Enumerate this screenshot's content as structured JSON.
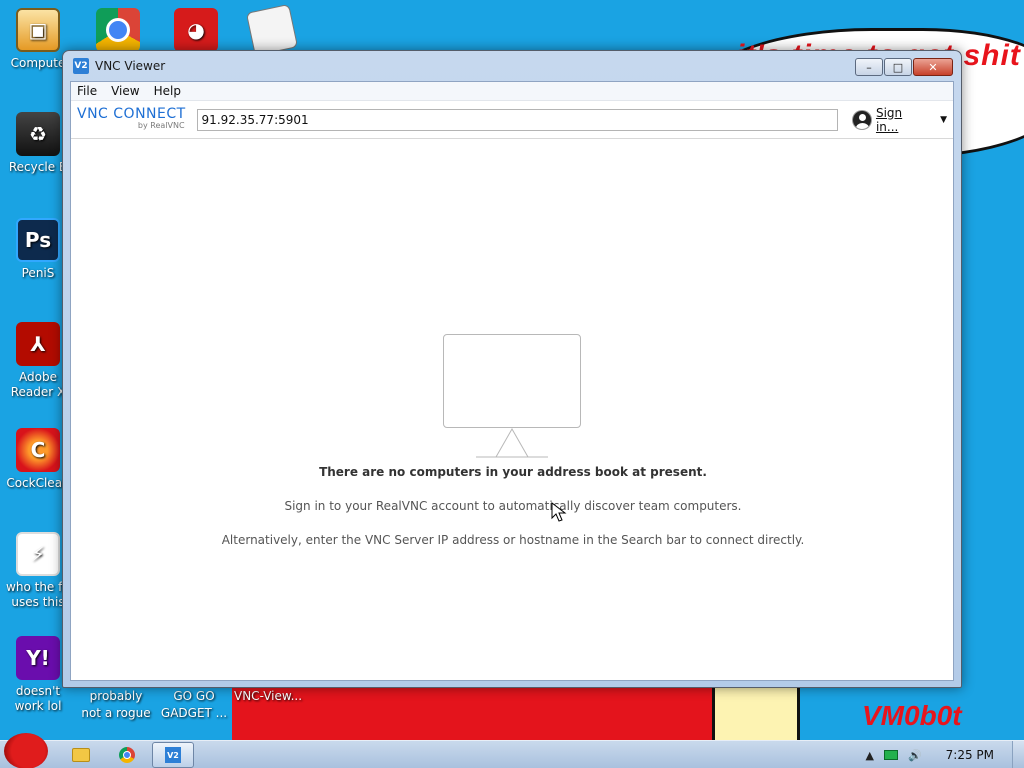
{
  "wallpaper": {
    "speech": "it's time to get shit\nnew",
    "sign": "VM0b0t"
  },
  "desktop_icons": [
    {
      "label": "Compute",
      "icon": "computer-icon"
    },
    {
      "label": "",
      "icon": "chrome-icon"
    },
    {
      "label": "",
      "icon": "angry-bird-icon"
    },
    {
      "label": "",
      "icon": "document-icon"
    },
    {
      "label": "Recycle B",
      "icon": "recycle-bin-icon"
    },
    {
      "label": "PeniS",
      "icon": "photoshop-icon"
    },
    {
      "label": "Adobe Reader X",
      "icon": "adobe-reader-icon"
    },
    {
      "label": "CockClean",
      "icon": "ccleaner-icon"
    },
    {
      "label": "who the fu uses this",
      "icon": "bolt-icon"
    },
    {
      "label": "doesn't work lol",
      "icon": "yahoo-icon"
    }
  ],
  "bottom_labels": [
    "probably not a rogue",
    "GO GO GADGET ...",
    "VNC-View..."
  ],
  "window": {
    "title": "VNC Viewer",
    "app_icon_text": "V2",
    "controls": {
      "minimize": "–",
      "maximize": "□",
      "close": "✕"
    }
  },
  "menu": [
    "File",
    "View",
    "Help"
  ],
  "brand": {
    "main": "VNC CONNECT",
    "sub": "by RealVNC"
  },
  "address_bar": {
    "value": "91.92.35.77:5901"
  },
  "signin": {
    "label": "Sign in...",
    "caret": "▼"
  },
  "empty_state": {
    "heading": "There are no computers in your address book at present.",
    "line1": "Sign in to your RealVNC account to automatically discover team computers.",
    "line2": "Alternatively, enter the VNC Server IP address or hostname in the Search bar to connect directly."
  },
  "taskbar": {
    "pinned": [
      "explorer-icon",
      "chrome-icon",
      "vnc-viewer-icon"
    ],
    "clock": "7:25 PM",
    "tray_arrow": "▲",
    "volume": "🔊"
  },
  "colors": {
    "desktop": "#1aa3e3",
    "brand": "#1e6fd4",
    "wallpaper_red": "#e4141c"
  }
}
